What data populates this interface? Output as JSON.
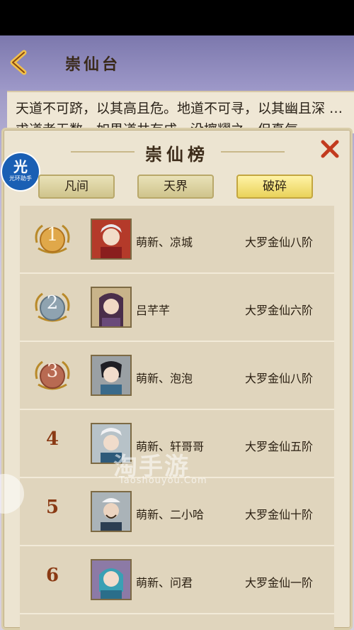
{
  "scene": {
    "title": "崇仙台"
  },
  "scroll_text": "天道不可跻，以其高且危。地道不可寻，以其幽且深 …求道者无数，如果道井有成…没擦耀之…但真气…",
  "panel": {
    "title": "崇仙榜"
  },
  "app_badge": {
    "big": "光",
    "small": "光环助手"
  },
  "tabs": [
    {
      "label": "凡间",
      "active": false
    },
    {
      "label": "天界",
      "active": false
    },
    {
      "label": "破碎",
      "active": true
    }
  ],
  "rows": [
    {
      "rank": "1",
      "medal": "gold",
      "name": "萌新、凉城",
      "level": "大罗金仙八阶"
    },
    {
      "rank": "2",
      "medal": "silver",
      "name": "吕芊芊",
      "level": "大罗金仙六阶"
    },
    {
      "rank": "3",
      "medal": "bronze",
      "name": "萌新、泡泡",
      "level": "大罗金仙八阶"
    },
    {
      "rank": "4",
      "medal": "",
      "name": "萌新、轩哥哥",
      "level": "大罗金仙五阶"
    },
    {
      "rank": "5",
      "medal": "",
      "name": "萌新、二小哈",
      "level": "大罗金仙十阶"
    },
    {
      "rank": "6",
      "medal": "",
      "name": "萌新、问君",
      "level": "大罗金仙一阶"
    }
  ],
  "watermark": {
    "main": "淘手游",
    "sub": "Taoshouyou.Com"
  },
  "colors": {
    "gold": "#d9a24a",
    "silver": "#8fa3b0",
    "bronze": "#c07a5a",
    "active_tab": "#e9d25a"
  }
}
